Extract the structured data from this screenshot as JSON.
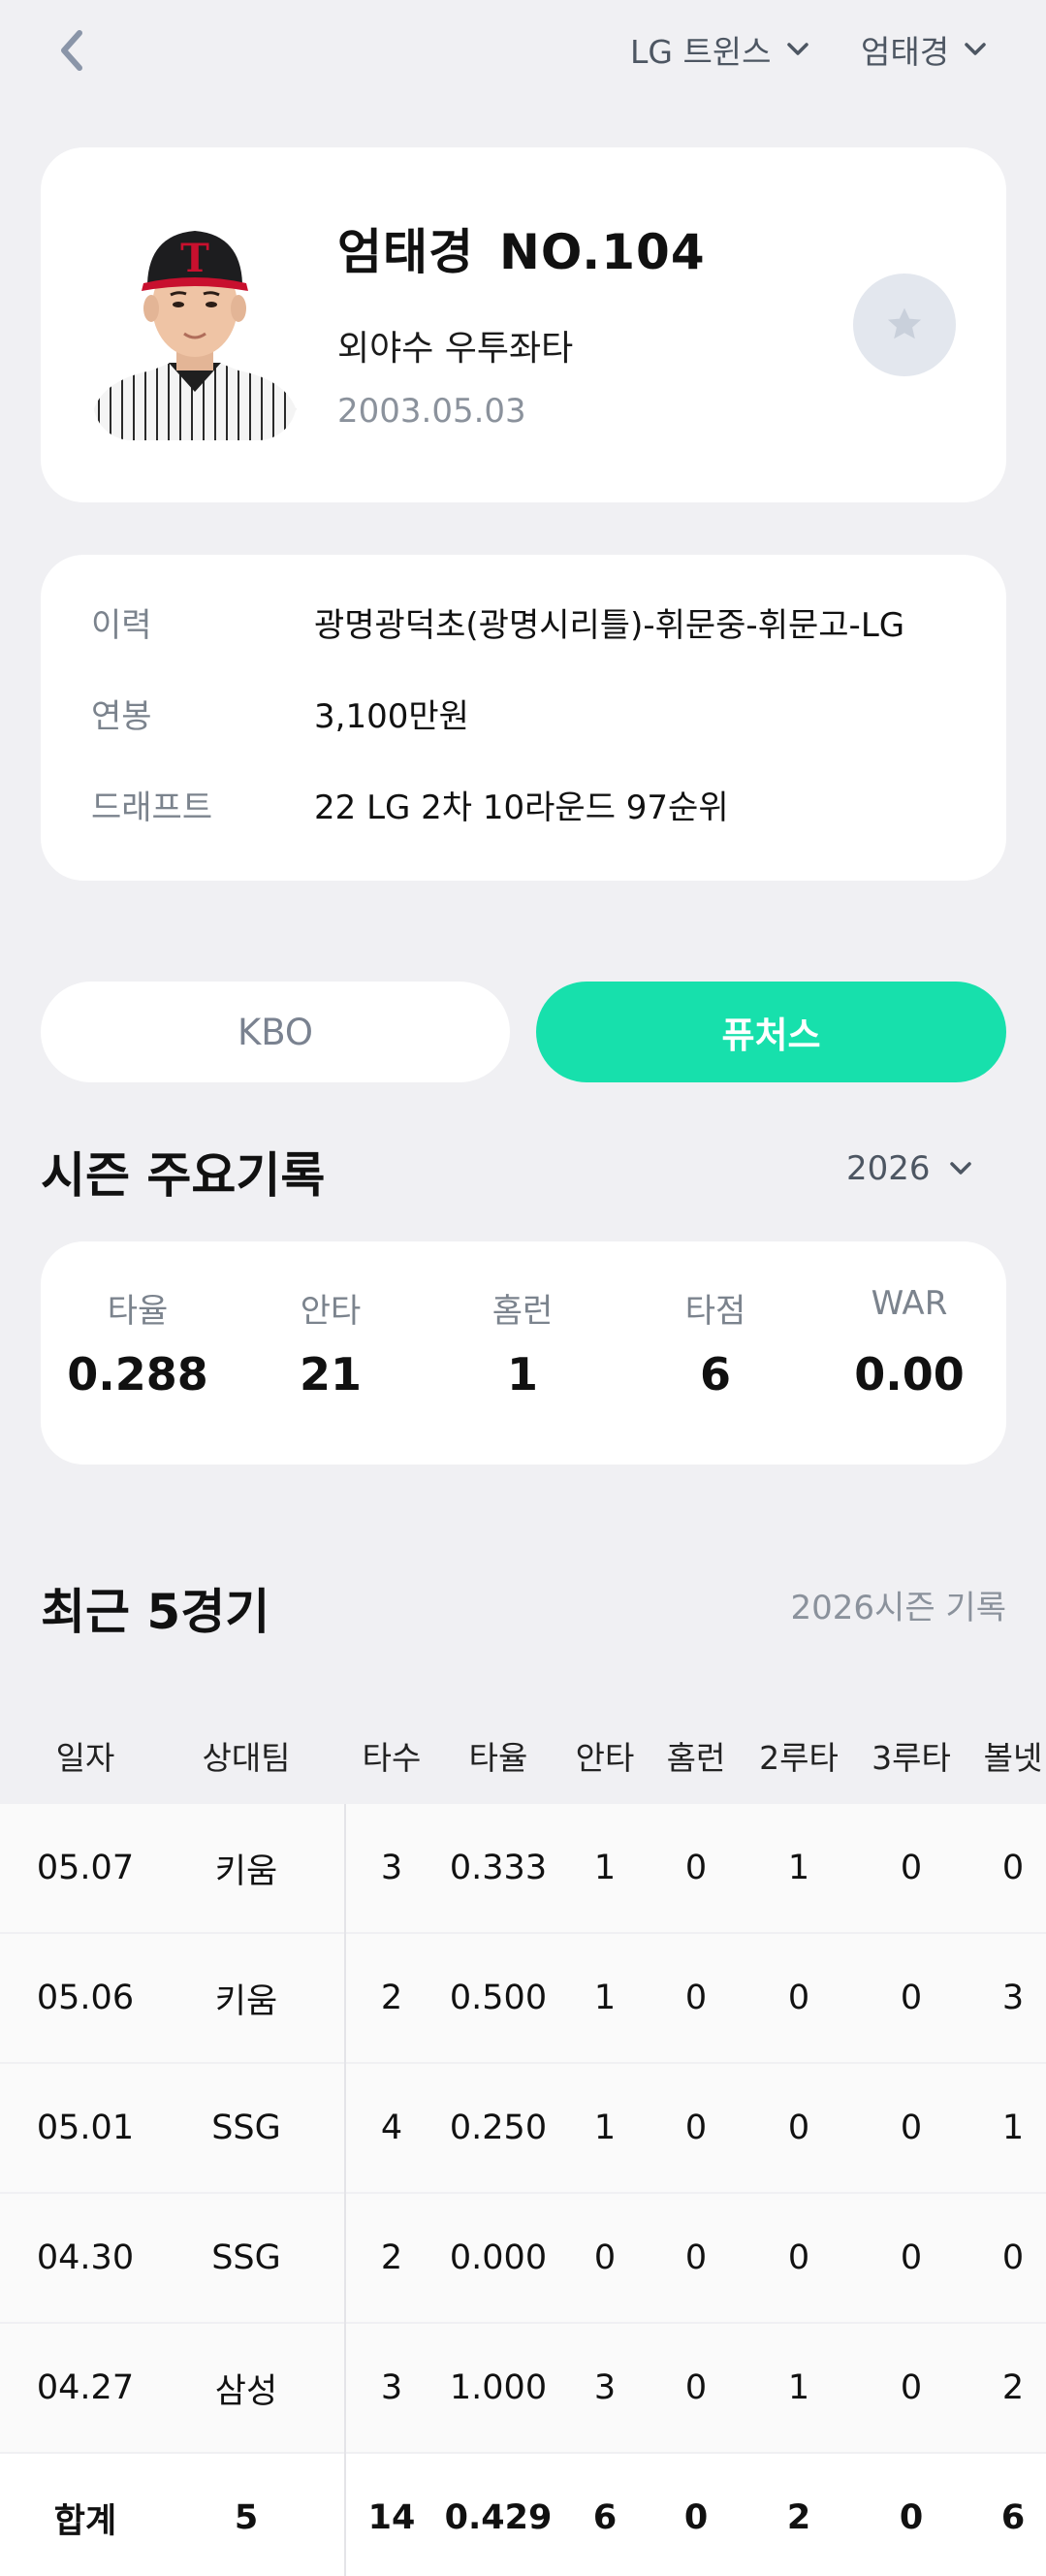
{
  "header": {
    "back_icon": "chevron-left-icon",
    "team_dropdown": "LG 트윈스",
    "player_dropdown": "엄태경"
  },
  "profile": {
    "name": "엄태경",
    "number": "NO.104",
    "position": "외야수 우투좌타",
    "birth": "2003.05.03",
    "favorite_icon": "star-icon"
  },
  "info": {
    "rows": [
      {
        "label": "이력",
        "value": "광명광덕초(광명시리틀)-휘문중-휘문고-LG"
      },
      {
        "label": "연봉",
        "value": "3,100만원"
      },
      {
        "label": "드래프트",
        "value": "22 LG 2차 10라운드 97순위"
      }
    ]
  },
  "league_tabs": {
    "kbo": "KBO",
    "futures": "퓨처스",
    "selected": "퓨처스"
  },
  "season": {
    "title": "시즌 주요기록",
    "year": "2026",
    "stats": [
      {
        "label": "타율",
        "value": "0.288"
      },
      {
        "label": "안타",
        "value": "21"
      },
      {
        "label": "홈런",
        "value": "1"
      },
      {
        "label": "타점",
        "value": "6"
      },
      {
        "label": "WAR",
        "value": "0.00"
      }
    ]
  },
  "recent": {
    "title": "최근 5경기",
    "subtitle": "2026시즌 기록",
    "columns": [
      "일자",
      "상대팀",
      "타수",
      "타율",
      "안타",
      "홈런",
      "2루타",
      "3루타",
      "볼넷"
    ],
    "rows": [
      [
        "05.07",
        "키움",
        "3",
        "0.333",
        "1",
        "0",
        "1",
        "0",
        "0"
      ],
      [
        "05.06",
        "키움",
        "2",
        "0.500",
        "1",
        "0",
        "0",
        "0",
        "3"
      ],
      [
        "05.01",
        "SSG",
        "4",
        "0.250",
        "1",
        "0",
        "0",
        "0",
        "1"
      ],
      [
        "04.30",
        "SSG",
        "2",
        "0.000",
        "0",
        "0",
        "0",
        "0",
        "0"
      ],
      [
        "04.27",
        "삼성",
        "3",
        "1.000",
        "3",
        "0",
        "1",
        "0",
        "2"
      ]
    ],
    "total": [
      "합계",
      "5",
      "14",
      "0.429",
      "6",
      "0",
      "2",
      "0",
      "6"
    ]
  },
  "colors": {
    "accent": "#17e0ac",
    "background": "#f0f0f3",
    "muted_text": "#7b838d"
  }
}
